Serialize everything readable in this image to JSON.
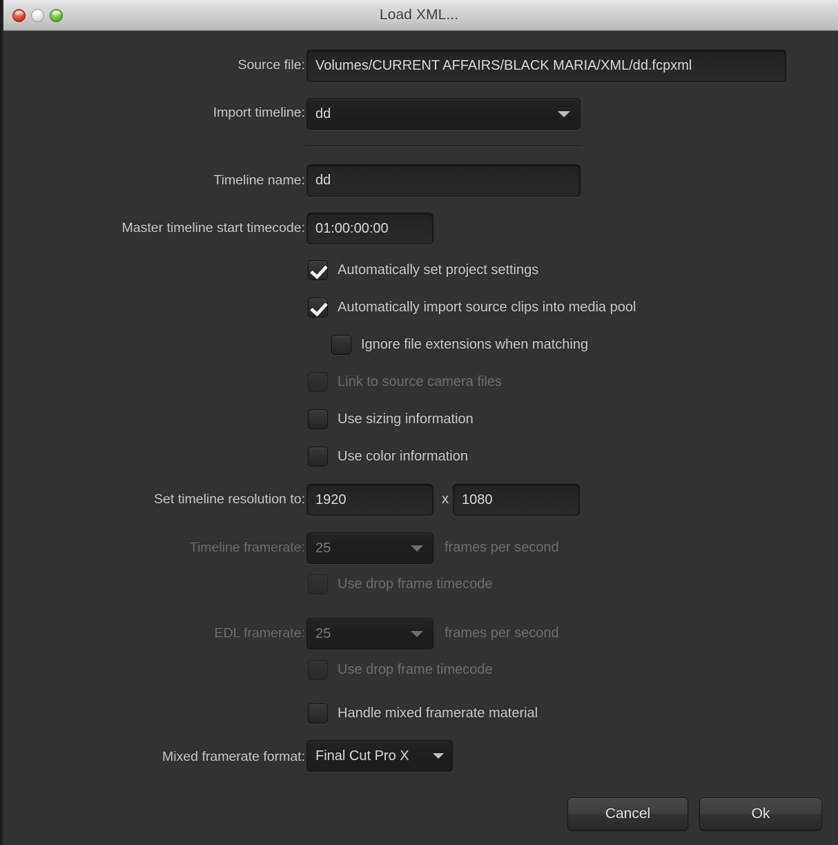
{
  "window": {
    "title": "Load XML...",
    "traffic_lights": [
      "close",
      "minimize",
      "zoom"
    ],
    "bg_color": "#323232",
    "accent_text_color": "#c9c9c9",
    "disabled_text_color": "#6d6d6d"
  },
  "form": {
    "source_file": {
      "label": "Source file:",
      "value": "Volumes/CURRENT AFFAIRS/BLACK MARIA/XML/dd.fcpxml"
    },
    "import_timeline": {
      "label": "Import timeline:",
      "value": "dd"
    },
    "timeline_name": {
      "label": "Timeline name:",
      "value": "dd"
    },
    "master_start_timecode": {
      "label": "Master timeline start timecode:",
      "value": "01:00:00:00"
    },
    "checkboxes": [
      {
        "label": "Automatically set project settings",
        "checked": true,
        "disabled": false,
        "indent": 0
      },
      {
        "label": "Automatically import source clips into media pool",
        "checked": true,
        "disabled": false,
        "indent": 0
      },
      {
        "label": "Ignore file extensions when matching",
        "checked": false,
        "disabled": false,
        "indent": 1
      },
      {
        "label": "Link to source camera files",
        "checked": false,
        "disabled": true,
        "indent": 0
      },
      {
        "label": "Use sizing information",
        "checked": false,
        "disabled": false,
        "indent": 0
      },
      {
        "label": "Use color information",
        "checked": false,
        "disabled": false,
        "indent": 0
      }
    ],
    "resolution": {
      "label": "Set timeline resolution to:",
      "width": "1920",
      "separator": "x",
      "height": "1080"
    },
    "timeline_framerate": {
      "label": "Timeline framerate:",
      "value": "25",
      "suffix": "frames per second",
      "disabled": true
    },
    "timeline_drop_frame": {
      "label": "Use drop frame timecode",
      "checked": false,
      "disabled": true
    },
    "edl_framerate": {
      "label": "EDL framerate:",
      "value": "25",
      "suffix": "frames per second",
      "disabled": true
    },
    "edl_drop_frame": {
      "label": "Use drop frame timecode",
      "checked": false,
      "disabled": true
    },
    "handle_mixed_framerate": {
      "label": "Handle mixed framerate material",
      "checked": false,
      "disabled": false
    },
    "mixed_framerate_format": {
      "label": "Mixed framerate format:",
      "value": "Final Cut Pro X"
    }
  },
  "footer": {
    "cancel_label": "Cancel",
    "ok_label": "Ok"
  }
}
